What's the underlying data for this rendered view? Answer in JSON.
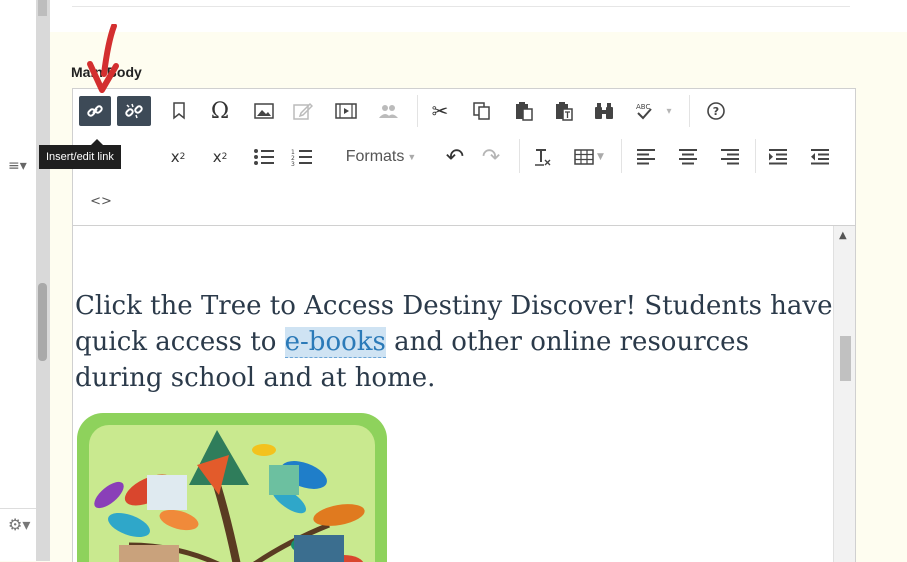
{
  "field": {
    "label": "Main Body"
  },
  "toolbar": {
    "row1": [
      {
        "name": "link-icon",
        "glyph": "🔗",
        "active": true
      },
      {
        "name": "unlink-icon",
        "glyph": "⛓",
        "active": true
      },
      {
        "name": "bookmark-icon",
        "glyph": "⛉"
      },
      {
        "name": "special-character-icon",
        "glyph": "Ω"
      },
      {
        "name": "insert-image-icon",
        "glyph": "▣"
      },
      {
        "name": "edit-image-icon",
        "glyph": "✎",
        "dim": true
      },
      {
        "name": "insert-media-icon",
        "glyph": "▤"
      },
      {
        "name": "people-icon",
        "glyph": "👥",
        "dim": true
      },
      {
        "name": "cut-icon",
        "glyph": "✂"
      },
      {
        "name": "copy-icon",
        "glyph": "⧉"
      },
      {
        "name": "paste-icon",
        "glyph": "📋"
      },
      {
        "name": "paste-text-icon",
        "glyph": "📄"
      },
      {
        "name": "find-replace-icon",
        "glyph": "⛯"
      },
      {
        "name": "spellcheck-icon",
        "glyph": "✓"
      },
      {
        "name": "spellcheck-dropdown-icon",
        "glyph": "▾",
        "dim": true
      },
      {
        "name": "help-icon",
        "glyph": "?"
      }
    ],
    "row2": [
      {
        "name": "superscript-icon",
        "glyph": "x²"
      },
      {
        "name": "subscript-icon",
        "glyph": "x₂"
      },
      {
        "name": "bullet-list-icon",
        "glyph": "☰"
      },
      {
        "name": "numbered-list-icon",
        "glyph": "☷"
      },
      {
        "name": "undo-icon",
        "glyph": "↶"
      },
      {
        "name": "redo-icon",
        "glyph": "↷",
        "dim": true
      },
      {
        "name": "clear-formatting-icon",
        "glyph": "T̸"
      },
      {
        "name": "table-icon",
        "glyph": "⊞"
      },
      {
        "name": "align-left-icon",
        "glyph": "≡"
      },
      {
        "name": "align-center-icon",
        "glyph": "≡"
      },
      {
        "name": "align-right-icon",
        "glyph": "≡"
      },
      {
        "name": "indent-icon",
        "glyph": "⇥"
      },
      {
        "name": "outdent-icon",
        "glyph": "⇤"
      }
    ],
    "formats_label": "Formats",
    "source_code_glyph": "<>"
  },
  "tooltip": {
    "text": "Insert/edit link"
  },
  "content": {
    "text_before": "Click the Tree to Access Destiny Discover!  Students have quick access to ",
    "link_text": "e-books",
    "text_after": " and other online resources during school and at home."
  },
  "colors": {
    "accent": "#d32f2f",
    "active_button": "#3d4a57",
    "link": "#2b7ab8"
  }
}
